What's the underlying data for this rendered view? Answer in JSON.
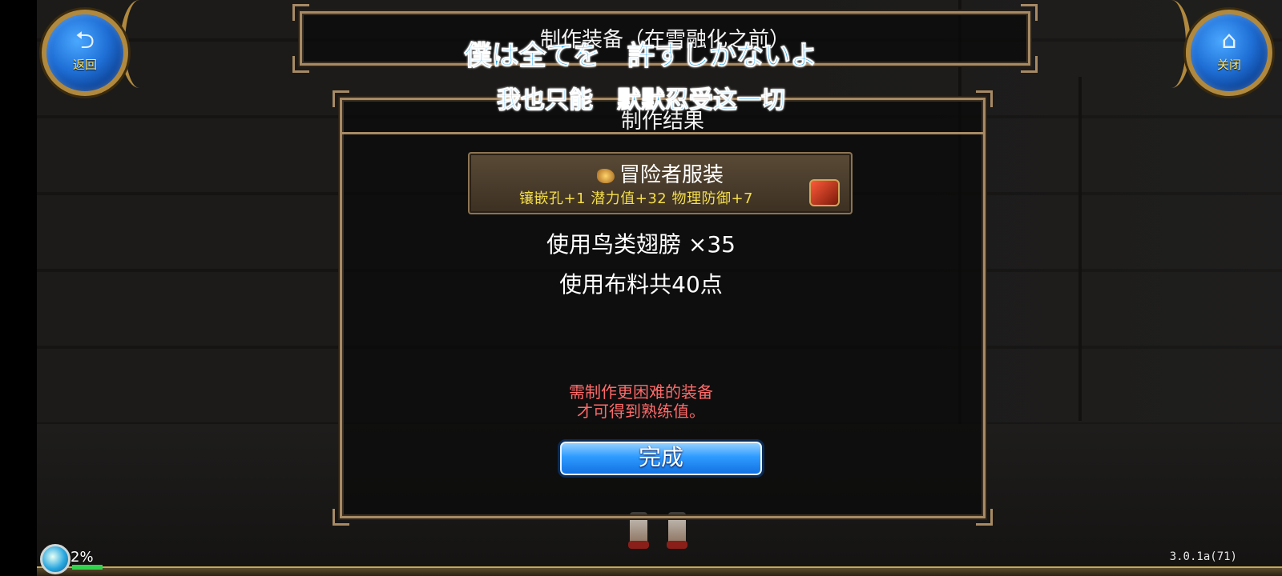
{
  "top_left_button": {
    "label": "返回",
    "icon": "back-arrow-icon"
  },
  "top_right_button": {
    "label": "关闭",
    "icon": "home-icon"
  },
  "top_title": "制作装备（在雪融化之前）",
  "subtitle_overlay": {
    "japanese": "僕は全てを　許すしかないよ",
    "chinese": "我也只能　默默忍受这一切"
  },
  "result_panel": {
    "title": "制作结果",
    "item": {
      "name": "冒险者服装",
      "stats": "镶嵌孔+1 潜力值+32 物理防御+7",
      "icon": "gem-icon",
      "badge_icon": "chest-icon"
    },
    "usage": [
      "使用鸟类翅膀 ×35",
      "使用布料共40点"
    ],
    "warning_line1": "需制作更困难的装备",
    "warning_line2": "才可得到熟练值。",
    "done_button": "完成"
  },
  "status": {
    "exp_percent": "2%",
    "version": "3.0.1a(71)"
  },
  "colors": {
    "overlay_text": "#29a8f0",
    "stats_text": "#f4de4a",
    "warning_text": "#ff6a6a",
    "frame_border": "#a78a64"
  }
}
